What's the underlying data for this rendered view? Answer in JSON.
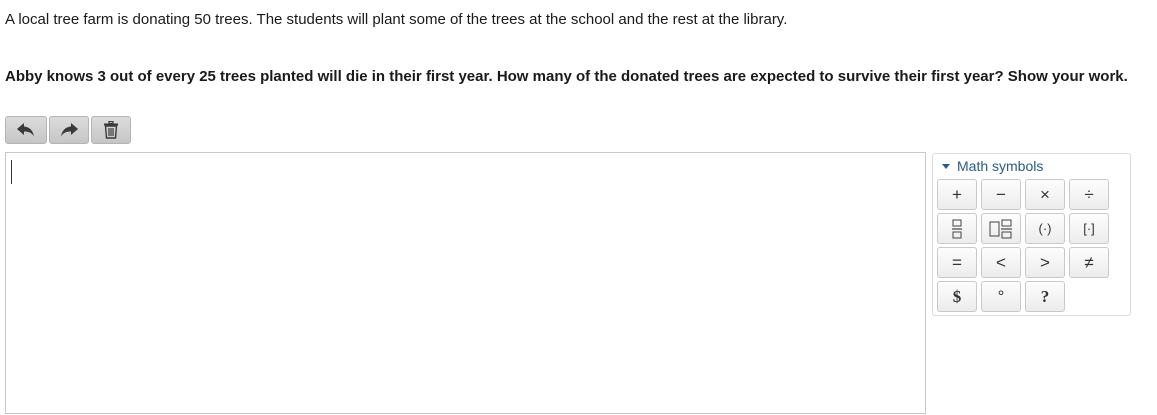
{
  "prompt": {
    "intro": "A local tree farm is donating 50 trees. The students will plant some of the trees at the school and the rest at the library.",
    "question": "Abby knows 3 out of every 25 trees planted will die in their first year. How many of the donated trees are expected to survive their first year? Show your work."
  },
  "toolbar": {
    "buttons": [
      {
        "icon": "undo-icon",
        "title": "Undo"
      },
      {
        "icon": "redo-icon",
        "title": "Redo"
      },
      {
        "icon": "trash-icon",
        "title": "Delete"
      }
    ]
  },
  "editor": {
    "value": ""
  },
  "math_panel": {
    "header": "Math symbols",
    "keys": {
      "plus": "+",
      "minus": "−",
      "times": "×",
      "divide": "÷",
      "fraction": "fraction-icon",
      "mixed_number": "mixed-number-icon",
      "parentheses": "(·)",
      "brackets": "[·]",
      "equals": "=",
      "less_than": "<",
      "greater_than": ">",
      "not_equal": "≠",
      "dollar": "$",
      "degree": "°",
      "question": "?"
    }
  }
}
